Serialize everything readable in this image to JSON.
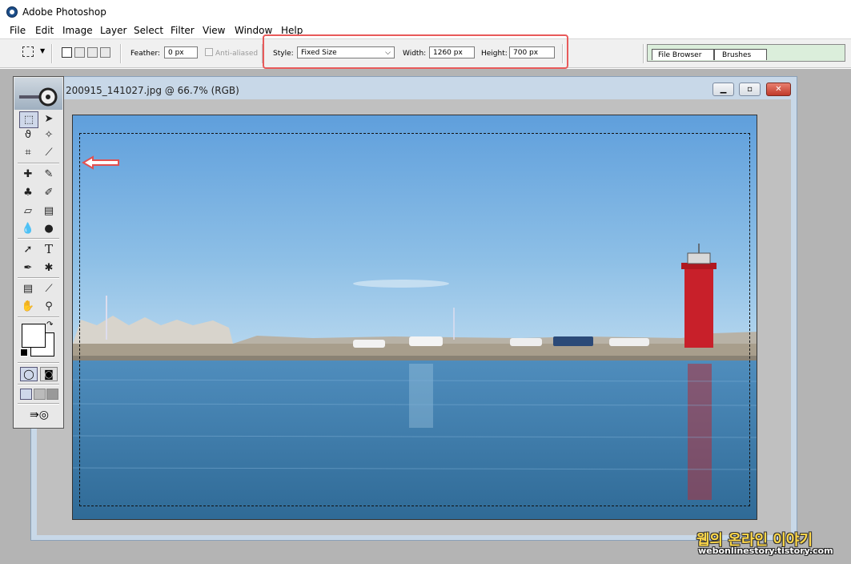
{
  "window": {
    "title": "Adobe Photoshop"
  },
  "menu": [
    "File",
    "Edit",
    "Image",
    "Layer",
    "Select",
    "Filter",
    "View",
    "Window",
    "Help"
  ],
  "options": {
    "feather_label": "Feather:",
    "feather_value": "0 px",
    "antialias_label": "Anti-aliased",
    "style_label": "Style:",
    "style_value": "Fixed Size",
    "width_label": "Width:",
    "width_value": "1260 px",
    "height_label": "Height:",
    "height_value": "700 px"
  },
  "palette_well": {
    "tabs": [
      "File Browser",
      "Brushes"
    ]
  },
  "document": {
    "title": "200915_141027.jpg @ 66.7% (RGB)"
  },
  "watermark": {
    "korean": "웹의 온라인 이야기",
    "url": "webonlinestory.tistory.com"
  },
  "colors": {
    "highlight": "#e85a5a",
    "sky": "#6fa6d8",
    "sea": "#3f7fae",
    "lighthouse": "#c8202a",
    "palette_well": "#dbeedb"
  },
  "icons": [
    "photoshop-logo-icon",
    "rect-marquee-icon",
    "move-icon",
    "lasso-icon",
    "magic-wand-icon",
    "crop-icon",
    "slice-icon",
    "healing-brush-icon",
    "brush-icon",
    "clone-stamp-icon",
    "history-brush-icon",
    "eraser-icon",
    "gradient-icon",
    "blur-icon",
    "dodge-icon",
    "path-select-icon",
    "type-icon",
    "pen-icon",
    "shape-icon",
    "notes-icon",
    "eyedropper-icon",
    "hand-icon",
    "zoom-icon",
    "swap-colors-icon",
    "default-colors-icon",
    "standard-mode-icon",
    "quickmask-mode-icon",
    "screen-mode-icon",
    "jump-to-imageready-icon",
    "minimize-icon",
    "restore-icon",
    "close-icon",
    "red-arrow-icon"
  ]
}
